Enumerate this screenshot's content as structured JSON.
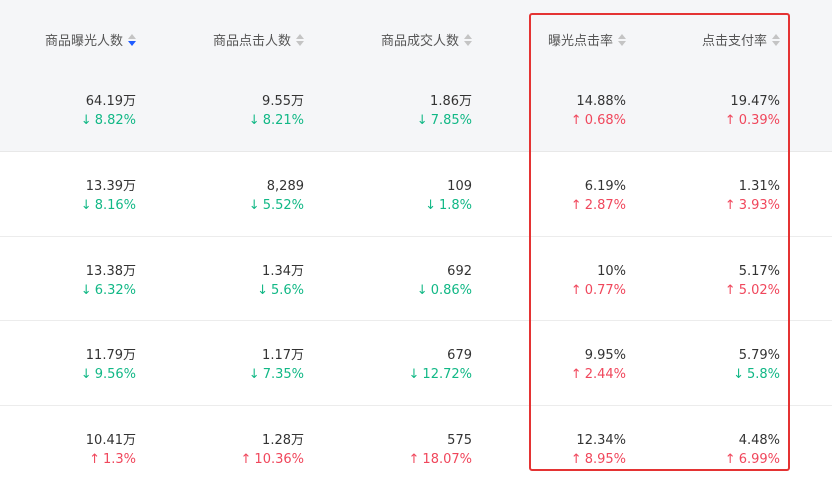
{
  "headers": [
    {
      "label": "商品曝光人数",
      "sorted": true
    },
    {
      "label": "商品点击人数",
      "sorted": false
    },
    {
      "label": "商品成交人数",
      "sorted": false
    },
    {
      "label": "曝光点击率",
      "sorted": false
    },
    {
      "label": "点击支付率",
      "sorted": false
    }
  ],
  "rows": [
    {
      "cells": [
        {
          "value": "64.19万",
          "change": "8.82%",
          "dir": "down"
        },
        {
          "value": "9.55万",
          "change": "8.21%",
          "dir": "down"
        },
        {
          "value": "1.86万",
          "change": "7.85%",
          "dir": "down"
        },
        {
          "value": "14.88%",
          "change": "0.68%",
          "dir": "up"
        },
        {
          "value": "19.47%",
          "change": "0.39%",
          "dir": "up"
        }
      ]
    },
    {
      "cells": [
        {
          "value": "13.39万",
          "change": "8.16%",
          "dir": "down"
        },
        {
          "value": "8,289",
          "change": "5.52%",
          "dir": "down"
        },
        {
          "value": "109",
          "change": "1.8%",
          "dir": "down"
        },
        {
          "value": "6.19%",
          "change": "2.87%",
          "dir": "up"
        },
        {
          "value": "1.31%",
          "change": "3.93%",
          "dir": "up"
        }
      ]
    },
    {
      "cells": [
        {
          "value": "13.38万",
          "change": "6.32%",
          "dir": "down"
        },
        {
          "value": "1.34万",
          "change": "5.6%",
          "dir": "down"
        },
        {
          "value": "692",
          "change": "0.86%",
          "dir": "down"
        },
        {
          "value": "10%",
          "change": "0.77%",
          "dir": "up"
        },
        {
          "value": "5.17%",
          "change": "5.02%",
          "dir": "up"
        }
      ]
    },
    {
      "cells": [
        {
          "value": "11.79万",
          "change": "9.56%",
          "dir": "down"
        },
        {
          "value": "1.17万",
          "change": "7.35%",
          "dir": "down"
        },
        {
          "value": "679",
          "change": "12.72%",
          "dir": "down"
        },
        {
          "value": "9.95%",
          "change": "2.44%",
          "dir": "up"
        },
        {
          "value": "5.79%",
          "change": "5.8%",
          "dir": "down"
        }
      ]
    },
    {
      "cells": [
        {
          "value": "10.41万",
          "change": "1.3%",
          "dir": "up"
        },
        {
          "value": "1.28万",
          "change": "10.36%",
          "dir": "up"
        },
        {
          "value": "575",
          "change": "18.07%",
          "dir": "up"
        },
        {
          "value": "12.34%",
          "change": "8.95%",
          "dir": "up"
        },
        {
          "value": "4.48%",
          "change": "6.99%",
          "dir": "up"
        }
      ]
    }
  ],
  "arrows": {
    "up": "↑",
    "down": "↓"
  },
  "colors": {
    "down": "#12b886",
    "up": "#f0475c",
    "highlight": "#e43333",
    "sort_active": "#1f5cff"
  }
}
